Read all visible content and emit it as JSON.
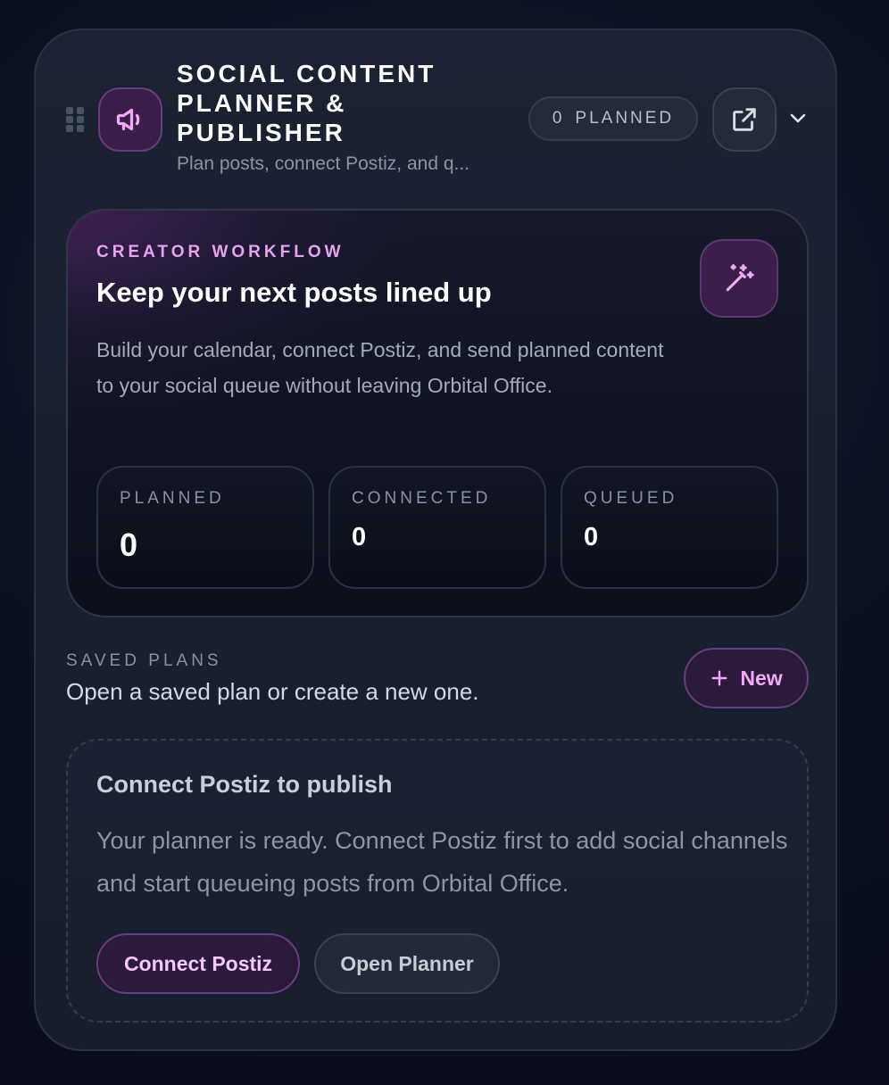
{
  "header": {
    "title": "SOCIAL CONTENT PLANNER & PUBLISHER",
    "subtitle": "Plan posts, connect Postiz, and q...",
    "planned_count": "0",
    "planned_label": "PLANNED"
  },
  "hero": {
    "eyebrow": "CREATOR WORKFLOW",
    "title": "Keep your next posts lined up",
    "body": "Build your calendar, connect Postiz, and send planned content to your social queue without leaving Orbital Office.",
    "stats": [
      {
        "label": "PLANNED",
        "value": "0"
      },
      {
        "label": "CONNECTED",
        "value": "0"
      },
      {
        "label": "QUEUED",
        "value": "0"
      }
    ]
  },
  "saved_plans": {
    "label": "SAVED PLANS",
    "description": "Open a saved plan or create a new one.",
    "new_button": "New"
  },
  "connect": {
    "title": "Connect Postiz to publish",
    "body": "Your planner is ready. Connect Postiz first to add social channels and start queueing posts from Orbital Office.",
    "primary_button": "Connect Postiz",
    "secondary_button": "Open Planner"
  },
  "icons": {
    "app": "megaphone-icon",
    "external": "open-external-icon",
    "collapse": "chevron-down-icon",
    "hero_action": "magic-wand-icon",
    "add": "plus-icon",
    "drag": "drag-handle-icon"
  },
  "colors": {
    "accent": "#e9a2f2",
    "accent_bg": "#3a1f48",
    "card_bg": "#1a2233",
    "page_bg": "#0b1020"
  }
}
